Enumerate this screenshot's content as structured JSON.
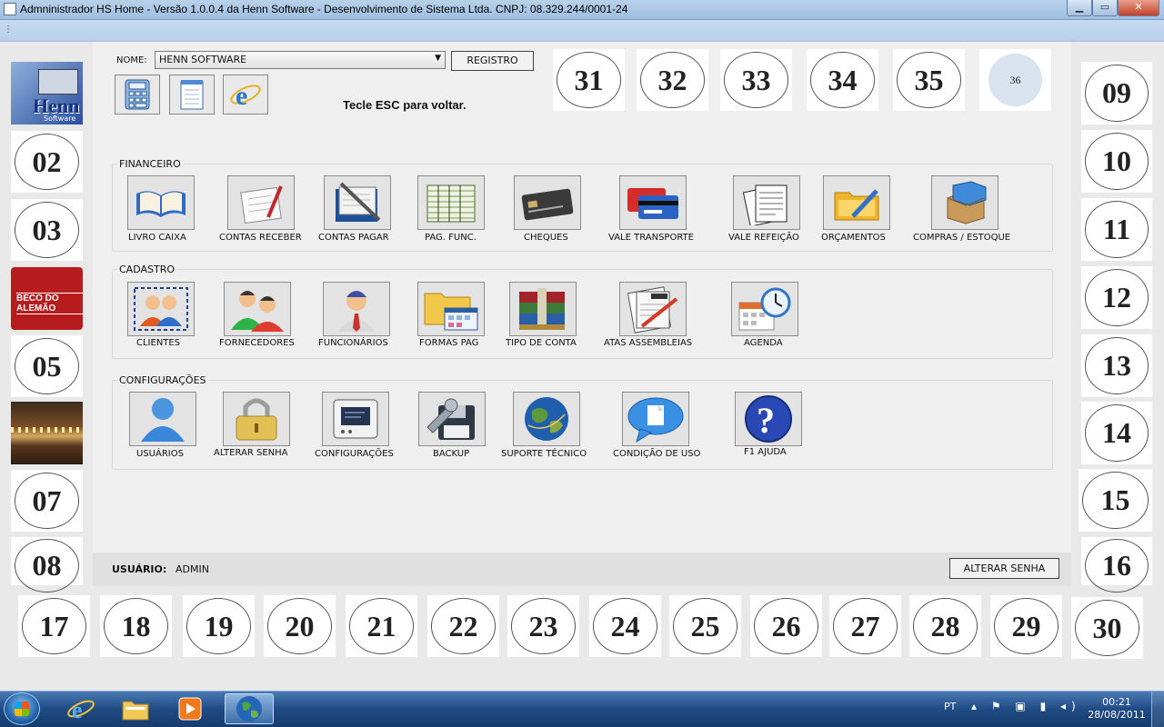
{
  "window": {
    "title": "Admninistrador HS Home - Versão 1.0.0.4 da Henn Software - Desenvolvimento de Sistema Ltda. CNPJ: 08.329.244/0001-24",
    "min_label": "▁",
    "max_label": "▭",
    "close_label": "✕"
  },
  "menubar": {
    "grip": "⋮"
  },
  "header": {
    "nome_label": "NOME:",
    "nome_value": "HENN SOFTWARE",
    "registro_label": "REGISTRO",
    "esc_hint": "Tecle ESC para voltar."
  },
  "left_tiles": [
    "02",
    "03",
    "05",
    "07",
    "08"
  ],
  "left_images": {
    "henn_brand": "Henn",
    "henn_sub": "Software",
    "beco_text": "BECO DO ALEMÃO"
  },
  "right_tiles": [
    "09",
    "10",
    "11",
    "12",
    "13",
    "14",
    "15",
    "16"
  ],
  "top_tiles": [
    "31",
    "32",
    "33",
    "34",
    "35",
    "36"
  ],
  "bottom_tiles": [
    "17",
    "18",
    "19",
    "20",
    "21",
    "22",
    "23",
    "24",
    "25",
    "26",
    "27",
    "28",
    "29",
    "30"
  ],
  "financeiro": {
    "title": "FINANCEIRO",
    "items": [
      "LIVRO CAIXA",
      "CONTAS RECEBER",
      "CONTAS PAGAR",
      "PAG. FUNC.",
      "CHEQUES",
      "VALE TRANSPORTE",
      "VALE REFEIÇÃO",
      "ORÇAMENTOS",
      "COMPRAS / ESTOQUE"
    ]
  },
  "cadastro": {
    "title": "CADASTRO",
    "items": [
      "CLIENTES",
      "FORNECEDORES",
      "FUNCIONÁRIOS",
      "FORMAS PAG",
      "TIPO DE CONTA",
      "ATAS  ASSEMBLEIAS",
      "AGENDA"
    ]
  },
  "configuracoes": {
    "title": "CONFIGURAÇÕES",
    "items": [
      "USUÁRIOS",
      "ALTERAR SENHA",
      "CONFIGURAÇÕES",
      "BACKUP",
      "SUPORTE TÉCNICO",
      "CONDIÇÃO DE USO",
      "F1 AJUDA"
    ]
  },
  "status": {
    "usuario_label": "USUÁRIO:",
    "usuario_value": "ADMIN",
    "alterar_senha_label": "ALTERAR SENHA"
  },
  "taskbar": {
    "lang": "PT",
    "tray": "▴ ⚑ ▣ ▮ ◂)",
    "time": "00:21",
    "date": "28/08/2011"
  }
}
